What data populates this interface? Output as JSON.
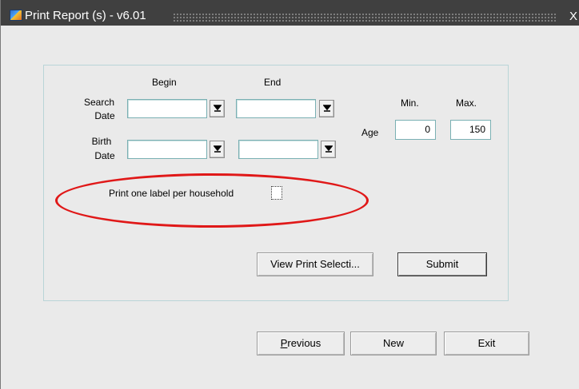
{
  "window": {
    "title": "Print Report (s) - v6.01",
    "close_glyph": "X"
  },
  "form": {
    "begin_header": "Begin",
    "end_header": "End",
    "search_date_label_line1": "Search",
    "search_date_label_line2": "Date",
    "birth_date_label_line1": "Birth",
    "birth_date_label_line2": "Date",
    "search_begin_value": "",
    "search_end_value": "",
    "birth_begin_value": "",
    "birth_end_value": "",
    "age_label": "Age",
    "min_header": "Min.",
    "max_header": "Max.",
    "age_min_value": "0",
    "age_max_value": "150",
    "household_label": "Print one label per household",
    "household_checked": false
  },
  "buttons": {
    "view_print_selection": "View Print Selecti...",
    "submit": "Submit",
    "previous_prefix": "",
    "previous_mnemonic": "P",
    "previous_rest": "revious",
    "new": "New",
    "exit": "Exit"
  },
  "annotation": {
    "ellipse_color": "#e01818"
  },
  "icons": {
    "app_icon": "app-logo-icon",
    "dropdown": "dropdown-arrow-icon"
  }
}
